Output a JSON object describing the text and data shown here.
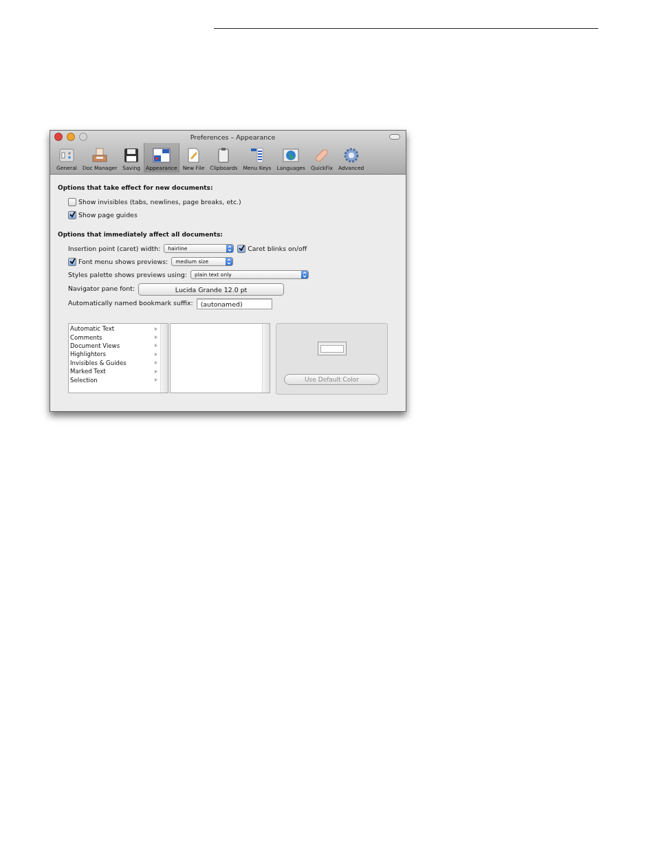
{
  "window": {
    "title": "Preferences – Appearance"
  },
  "toolbar": [
    {
      "label": "General",
      "selected": false
    },
    {
      "label": "Doc Manager",
      "selected": false
    },
    {
      "label": "Saving",
      "selected": false
    },
    {
      "label": "Appearance",
      "selected": true
    },
    {
      "label": "New File",
      "selected": false
    },
    {
      "label": "Clipboards",
      "selected": false
    },
    {
      "label": "Menu Keys",
      "selected": false
    },
    {
      "label": "Languages",
      "selected": false
    },
    {
      "label": "QuickFix",
      "selected": false
    },
    {
      "label": "Advanced",
      "selected": false
    }
  ],
  "sections": [
    {
      "heading": "Options that take effect for new documents:",
      "rows": [
        {
          "controls": [
            {
              "kind": "checkbox",
              "label": "Show invisibles (tabs, newlines, page breaks, etc.)",
              "checked": false
            }
          ]
        },
        {
          "controls": [
            {
              "kind": "checkbox",
              "label": "Show page guides",
              "checked": true
            }
          ]
        }
      ]
    },
    {
      "heading": "Options that immediately affect all documents:",
      "rows": [
        {
          "controls": [
            {
              "kind": "label",
              "label": "Insertion point (caret) width:"
            },
            {
              "kind": "popup",
              "value": "hairline"
            },
            {
              "kind": "checkbox",
              "label": "Caret blinks on/off",
              "checked": true
            }
          ]
        },
        {
          "controls": [
            {
              "kind": "checkbox",
              "label": "Font menu shows previews:",
              "checked": true
            },
            {
              "kind": "popup",
              "value": "medium size"
            }
          ]
        },
        {
          "controls": [
            {
              "kind": "label",
              "label": "Styles palette shows previews using:"
            },
            {
              "kind": "popup",
              "value": "plain text only"
            }
          ]
        },
        {
          "controls": [
            {
              "kind": "label",
              "label": "Navigator pane font:"
            },
            {
              "kind": "button",
              "label": "Lucida Grande 12.0 pt"
            }
          ]
        },
        {
          "controls": [
            {
              "kind": "label",
              "label": "Automatically named bookmark suffix:"
            },
            {
              "kind": "field",
              "value": "(autonamed)"
            }
          ]
        }
      ]
    }
  ],
  "categories": [
    {
      "label": "Automatic Text"
    },
    {
      "label": "Comments"
    },
    {
      "label": "Document Views"
    },
    {
      "label": "Highlighters"
    },
    {
      "label": "Invisibles & Guides"
    },
    {
      "label": "Marked Text"
    },
    {
      "label": "Selection"
    }
  ],
  "color_panel": {
    "button": {
      "label": "Use Default Color",
      "disabled": true
    }
  }
}
